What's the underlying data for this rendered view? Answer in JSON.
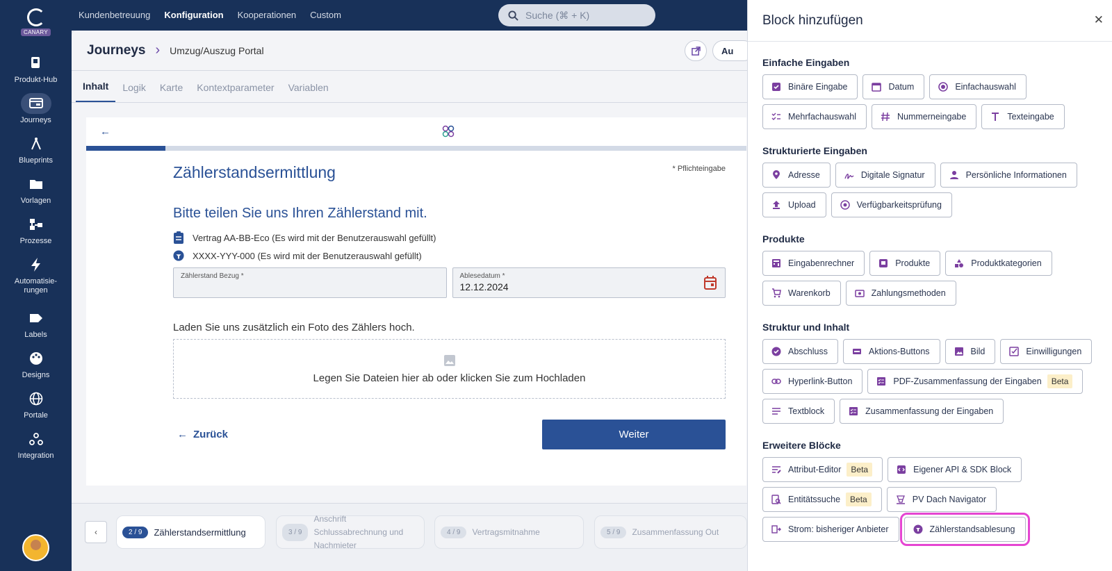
{
  "app": {
    "brand_badge": "CANARY"
  },
  "sidebar": {
    "items": [
      {
        "label": "Produkt-Hub",
        "icon": "bookmark-icon"
      },
      {
        "label": "Journeys",
        "icon": "journeys-icon",
        "active": true
      },
      {
        "label": "Blueprints",
        "icon": "compass-icon"
      },
      {
        "label": "Vorlagen",
        "icon": "folder-icon"
      },
      {
        "label": "Prozesse",
        "icon": "process-icon"
      },
      {
        "label": "Automatisie-\nrungen",
        "icon": "bolt-icon"
      },
      {
        "label": "Labels",
        "icon": "label-icon"
      },
      {
        "label": "Designs",
        "icon": "palette-icon"
      },
      {
        "label": "Portale",
        "icon": "globe-icon"
      },
      {
        "label": "Integration",
        "icon": "webhook-icon"
      }
    ]
  },
  "topnav": {
    "items": [
      "Kundenbetreuung",
      "Konfiguration",
      "Kooperationen",
      "Custom"
    ],
    "search_placeholder": "Suche (⌘ + K)"
  },
  "header": {
    "title": "Journeys",
    "subtitle": "Umzug/Auszug Portal",
    "button_partial": "Au"
  },
  "tabs": [
    "Inhalt",
    "Logik",
    "Karte",
    "Kontextparameter",
    "Variablen"
  ],
  "form": {
    "progress": 0.12,
    "title": "Zählerstandsermittlung",
    "required_note": "* Pflichteingabe",
    "question": "Bitte teilen Sie uns Ihren Zählerstand mit.",
    "info1": "Vertrag AA-BB-Eco (Es wird mit der Benutzerauswahl gefüllt)",
    "info2": "XXXX-YYY-000 (Es wird mit der Benutzerauswahl gefüllt)",
    "field1_label": "Zählerstand Bezug *",
    "field1_value": "",
    "field2_label": "Ablesedatum *",
    "field2_value": "12.12.2024",
    "upload_label": "Laden Sie uns zusätzlich ein Foto des Zählers hoch.",
    "dropzone_text": "Legen Sie Dateien hier ab oder klicken Sie zum Hochladen",
    "back_label": "Zurück",
    "next_label": "Weiter"
  },
  "steps": [
    {
      "num": "2 / 9",
      "label": "Zählerstandsermittlung",
      "active": true
    },
    {
      "num": "3 / 9",
      "label": "Anschrift Schlussabrechnung und Nachmieter"
    },
    {
      "num": "4 / 9",
      "label": "Vertragsmitnahme"
    },
    {
      "num": "5 / 9",
      "label": "Zusammenfassung Out"
    }
  ],
  "panel": {
    "title": "Block hinzufügen",
    "sections": [
      {
        "title": "Einfache Eingaben",
        "chips": [
          {
            "label": "Binäre Eingabe",
            "icon": "checkbox-icon"
          },
          {
            "label": "Datum",
            "icon": "calendar-icon"
          },
          {
            "label": "Einfachauswahl",
            "icon": "radio-icon"
          },
          {
            "label": "Mehrfachauswahl",
            "icon": "checklist-icon"
          },
          {
            "label": "Nummerneingabe",
            "icon": "hash-icon"
          },
          {
            "label": "Texteingabe",
            "icon": "text-icon"
          }
        ]
      },
      {
        "title": "Strukturierte Eingaben",
        "chips": [
          {
            "label": "Adresse",
            "icon": "location-pin-icon"
          },
          {
            "label": "Digitale Signatur",
            "icon": "signature-icon"
          },
          {
            "label": "Persönliche Informationen",
            "icon": "person-icon"
          },
          {
            "label": "Upload",
            "icon": "upload-icon"
          },
          {
            "label": "Verfügbarkeitsprüfung",
            "icon": "availability-icon"
          }
        ]
      },
      {
        "title": "Produkte",
        "chips": [
          {
            "label": "Eingabenrechner",
            "icon": "calculator-icon"
          },
          {
            "label": "Produkte",
            "icon": "product-icon"
          },
          {
            "label": "Produktkategorien",
            "icon": "categories-icon"
          },
          {
            "label": "Warenkorb",
            "icon": "cart-icon"
          },
          {
            "label": "Zahlungsmethoden",
            "icon": "payment-icon"
          }
        ]
      },
      {
        "title": "Struktur und Inhalt",
        "chips": [
          {
            "label": "Abschluss",
            "icon": "verified-icon"
          },
          {
            "label": "Aktions-Buttons",
            "icon": "button-icon"
          },
          {
            "label": "Bild",
            "icon": "image-icon"
          },
          {
            "label": "Einwilligungen",
            "icon": "consent-icon"
          },
          {
            "label": "Hyperlink-Button",
            "icon": "link-icon"
          },
          {
            "label": "PDF-Zusammenfassung der Eingaben",
            "icon": "pdf-summary-icon",
            "badge": "Beta"
          },
          {
            "label": "Textblock",
            "icon": "lines-icon"
          },
          {
            "label": "Zusammenfassung der Eingaben",
            "icon": "summary-icon"
          }
        ]
      },
      {
        "title": "Erweitere Blöcke",
        "chips": [
          {
            "label": "Attribut-Editor",
            "icon": "attribute-editor-icon",
            "badge": "Beta"
          },
          {
            "label": "Eigener API & SDK Block",
            "icon": "code-icon"
          },
          {
            "label": "Entitätssuche",
            "icon": "entity-search-icon",
            "badge": "Beta"
          },
          {
            "label": "PV Dach Navigator",
            "icon": "solar-icon"
          },
          {
            "label": "Strom: bisheriger Anbieter",
            "icon": "provider-icon"
          },
          {
            "label": "Zählerstandsablesung",
            "icon": "meter-icon",
            "highlight": true
          }
        ]
      }
    ]
  },
  "colors": {
    "sidebar": "#183159",
    "accent": "#2a5196",
    "icon_purple": "#7b3fa0",
    "highlight": "#e545d2"
  }
}
